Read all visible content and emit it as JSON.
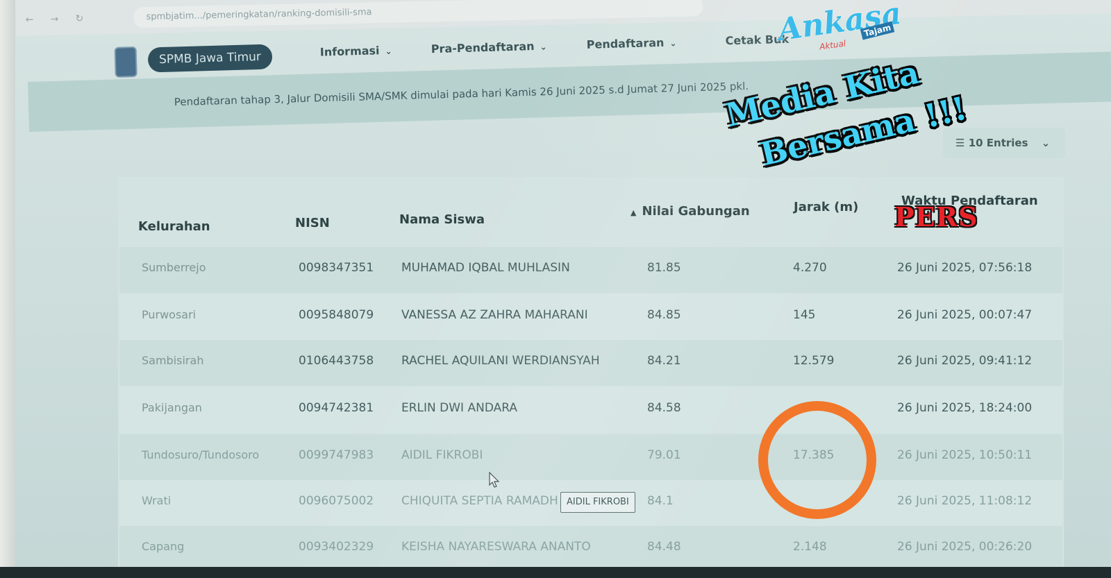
{
  "browser": {
    "url": "spmbjatim.../pemeringkatan/ranking-domisili-sma",
    "back_icon": "arrow-left-icon",
    "forward_icon": "arrow-right-icon",
    "reload_icon": "reload-icon"
  },
  "navbar": {
    "brand": "SPMB Jawa Timur",
    "items": [
      {
        "label": "Informasi"
      },
      {
        "label": "Pra-Pendaftaran"
      },
      {
        "label": "Pendaftaran"
      },
      {
        "label": "Cetak Buk"
      }
    ]
  },
  "announcement": {
    "text": "Pendaftaran tahap 3, Jalur Domisili SMA/SMK dimulai pada hari Kamis 26 Juni 2025 s.d Jumat 27 Juni 2025 pkl."
  },
  "entries_select": {
    "label": "10 Entries"
  },
  "table": {
    "headers": {
      "kelurahan": "Kelurahan",
      "nisn": "NISN",
      "nama": "Nama Siswa",
      "nilai": "Nilai Gabungan",
      "jarak": "Jarak (m)",
      "waktu": "Waktu Pendaftaran"
    },
    "sort_icon": "sort-up-icon",
    "rows": [
      {
        "kelurahan": "Sumberrejo",
        "nisn": "0098347351",
        "nama": "MUHAMAD IQBAL MUHLASIN",
        "nilai": "81.85",
        "jarak": "4.270",
        "waktu": "26 Juni 2025, 07:56:18"
      },
      {
        "kelurahan": "Purwosari",
        "nisn": "0095848079",
        "nama": "VANESSA AZ ZAHRA MAHARANI",
        "nilai": "84.85",
        "jarak": "145",
        "waktu": "26 Juni 2025, 00:07:47"
      },
      {
        "kelurahan": "Sambisirah",
        "nisn": "0106443758",
        "nama": "RACHEL AQUILANI WERDIANSYAH",
        "nilai": "84.21",
        "jarak": "12.579",
        "waktu": "26 Juni 2025, 09:41:12"
      },
      {
        "kelurahan": "Pakijangan",
        "nisn": "0094742381",
        "nama": "ERLIN DWI ANDARA",
        "nilai": "84.58",
        "jarak": "",
        "waktu": "26 Juni 2025, 18:24:00"
      },
      {
        "kelurahan": "Tundosuro/Tundosoro",
        "nisn": "0099747983",
        "nama": "AIDIL FIKROBI",
        "nilai": "79.01",
        "jarak": "17.385",
        "waktu": "26 Juni 2025, 10:50:11"
      },
      {
        "kelurahan": "Wrati",
        "nisn": "0096075002",
        "nama": "CHIQUITA SEPTIA RAMADH",
        "nilai": "84.1",
        "jarak": "",
        "waktu": "26 Juni 2025, 11:08:12"
      },
      {
        "kelurahan": "Capang",
        "nisn": "0093402329",
        "nama": "KEISHA NAYARESWARA ANANTO",
        "nilai": "84.48",
        "jarak": "2.148",
        "waktu": "26 Juni 2025, 00:26:20"
      }
    ]
  },
  "tooltip": {
    "text": "AIDIL FIKROBI"
  },
  "watermark": {
    "brand": "Ankasa",
    "tagline_small": "Tajam",
    "sub": "Aktual",
    "slogan_line1": "Media Kita",
    "slogan_line2": "Bersama !!!",
    "badge": "PERS"
  },
  "colors": {
    "highlight_circle": "#f2772a",
    "watermark_blue": "#3cd0f5",
    "pers_red": "#e8242a"
  }
}
